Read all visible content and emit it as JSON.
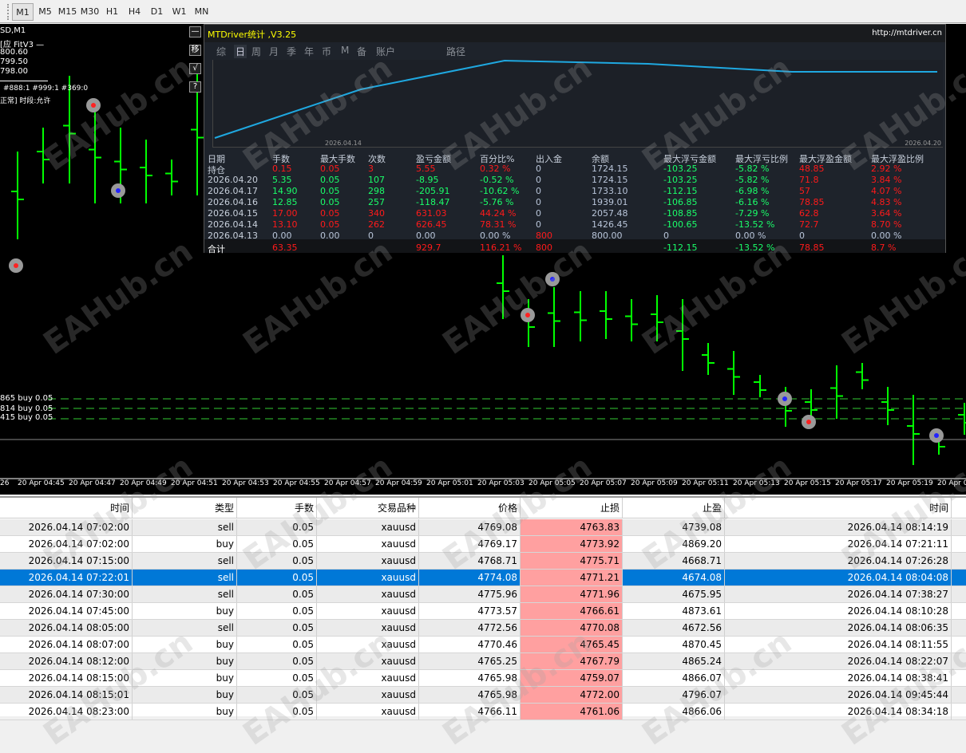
{
  "toolbar": {
    "timeframes": [
      "M1",
      "M5",
      "M15",
      "M30",
      "H1",
      "H4",
      "D1",
      "W1",
      "MN"
    ],
    "active": "M1"
  },
  "chart": {
    "info_lines": [
      "SD,M1",
      "[应 FitV3 —",
      "800.60",
      "799.50",
      "798.00"
    ],
    "status_line1": "#888:1  #999:1  #369:0",
    "status_line2": "正常] 时段:允许",
    "side_buttons": [
      "—",
      "移",
      "√",
      "?"
    ],
    "order_lines": [
      "865 buy 0.05",
      "814 buy 0.05",
      "415 buy 0.05"
    ],
    "time_labels": [
      "26",
      "20 Apr 04:45",
      "20 Apr 04:47",
      "20 Apr 04:49",
      "20 Apr 04:51",
      "20 Apr 04:53",
      "20 Apr 04:55",
      "20 Apr 04:57",
      "20 Apr 04:59",
      "20 Apr 05:01",
      "20 Apr 05:03",
      "20 Apr 05:05",
      "20 Apr 05:07",
      "20 Apr 05:09",
      "20 Apr 05:11",
      "20 Apr 05:13",
      "20 Apr 05:15",
      "20 Apr 05:17",
      "20 Apr 05:19",
      "20 Apr 05:21"
    ],
    "up_color": "#00ff00"
  },
  "panel": {
    "title": "MTDriver统计 ,V3.25",
    "url": "http://mtdriver.cn",
    "tabs": [
      "综",
      "日",
      "周",
      "月",
      "季",
      "年",
      "币",
      "M",
      "备",
      "账户",
      "路径"
    ],
    "active_tab": "日",
    "equity": {
      "start_label": "2026.04.14",
      "end_label": "2026.04.20",
      "color": "#1fa8e0"
    },
    "headers": [
      "日期",
      "手数",
      "最大手数",
      "次数",
      "盈亏金额",
      "百分比%",
      "出入金",
      "余额",
      "最大浮亏金额",
      "最大浮亏比例",
      "最大浮盈金额",
      "最大浮盈比例"
    ],
    "rows": [
      [
        "持仓",
        "0.15",
        "0.05",
        "3",
        "5.55",
        "0.32 %",
        "0",
        "1724.15",
        "-103.25",
        "-5.82 %",
        "48.85",
        "2.92 %"
      ],
      [
        "2026.04.20",
        "5.35",
        "0.05",
        "107",
        "-8.95",
        "-0.52 %",
        "0",
        "1724.15",
        "-103.25",
        "-5.82 %",
        "71.8",
        "3.84 %"
      ],
      [
        "2026.04.17",
        "14.90",
        "0.05",
        "298",
        "-205.91",
        "-10.62 %",
        "0",
        "1733.10",
        "-112.15",
        "-6.98 %",
        "57",
        "4.07 %"
      ],
      [
        "2026.04.16",
        "12.85",
        "0.05",
        "257",
        "-118.47",
        "-5.76 %",
        "0",
        "1939.01",
        "-106.85",
        "-6.16 %",
        "78.85",
        "4.83 %"
      ],
      [
        "2026.04.15",
        "17.00",
        "0.05",
        "340",
        "631.03",
        "44.24 %",
        "0",
        "2057.48",
        "-108.85",
        "-7.29 %",
        "62.8",
        "3.64 %"
      ],
      [
        "2026.04.14",
        "13.10",
        "0.05",
        "262",
        "626.45",
        "78.31 %",
        "0",
        "1426.45",
        "-100.65",
        "-13.52 %",
        "72.7",
        "8.70 %"
      ],
      [
        "2026.04.13",
        "0.00",
        "0.00",
        "0",
        "0.00",
        "0.00 %",
        "800",
        "800.00",
        "0",
        "0.00 %",
        "0",
        "0.00 %"
      ]
    ],
    "total": [
      "合计",
      "63.35",
      "",
      "",
      "929.7",
      "116.21 %",
      "800",
      "",
      "-112.15",
      "-13.52 %",
      "78.85",
      "8.7 %"
    ],
    "colors": {
      "profit": "#ff1a1a",
      "loss": "#1aff6a",
      "neutral": "#b8c4d8"
    }
  },
  "table": {
    "headers": [
      "时间",
      "类型",
      "手数",
      "交易品种",
      "价格",
      "止损",
      "止盈",
      "时间"
    ],
    "selected_index": 3,
    "rows": [
      [
        "2026.04.14 07:02:00",
        "sell",
        "0.05",
        "xauusd",
        "4769.08",
        "4763.83",
        "4739.08",
        "2026.04.14 08:14:19"
      ],
      [
        "2026.04.14 07:02:00",
        "buy",
        "0.05",
        "xauusd",
        "4769.17",
        "4773.92",
        "4869.20",
        "2026.04.14 07:21:11"
      ],
      [
        "2026.04.14 07:15:00",
        "sell",
        "0.05",
        "xauusd",
        "4768.71",
        "4775.71",
        "4668.71",
        "2026.04.14 07:26:28"
      ],
      [
        "2026.04.14 07:22:01",
        "sell",
        "0.05",
        "xauusd",
        "4774.08",
        "4771.21",
        "4674.08",
        "2026.04.14 08:04:08"
      ],
      [
        "2026.04.14 07:30:00",
        "sell",
        "0.05",
        "xauusd",
        "4775.96",
        "4771.96",
        "4675.95",
        "2026.04.14 07:38:27"
      ],
      [
        "2026.04.14 07:45:00",
        "buy",
        "0.05",
        "xauusd",
        "4773.57",
        "4766.61",
        "4873.61",
        "2026.04.14 08:10:28"
      ],
      [
        "2026.04.14 08:05:00",
        "sell",
        "0.05",
        "xauusd",
        "4772.56",
        "4770.08",
        "4672.56",
        "2026.04.14 08:06:35"
      ],
      [
        "2026.04.14 08:07:00",
        "buy",
        "0.05",
        "xauusd",
        "4770.46",
        "4765.45",
        "4870.45",
        "2026.04.14 08:11:55"
      ],
      [
        "2026.04.14 08:12:00",
        "buy",
        "0.05",
        "xauusd",
        "4765.25",
        "4767.79",
        "4865.24",
        "2026.04.14 08:22:07"
      ],
      [
        "2026.04.14 08:15:00",
        "buy",
        "0.05",
        "xauusd",
        "4765.98",
        "4759.07",
        "4866.07",
        "2026.04.14 08:38:41"
      ],
      [
        "2026.04.14 08:15:01",
        "buy",
        "0.05",
        "xauusd",
        "4765.98",
        "4772.00",
        "4796.07",
        "2026.04.14 09:45:44"
      ],
      [
        "2026.04.14 08:23:00",
        "buy",
        "0.05",
        "xauusd",
        "4766.11",
        "4761.06",
        "4866.06",
        "2026.04.14 08:34:18"
      ]
    ],
    "sl_color": "#ffa0a0",
    "selected_color": "#0078d7"
  },
  "watermark": "EAHub.cn"
}
